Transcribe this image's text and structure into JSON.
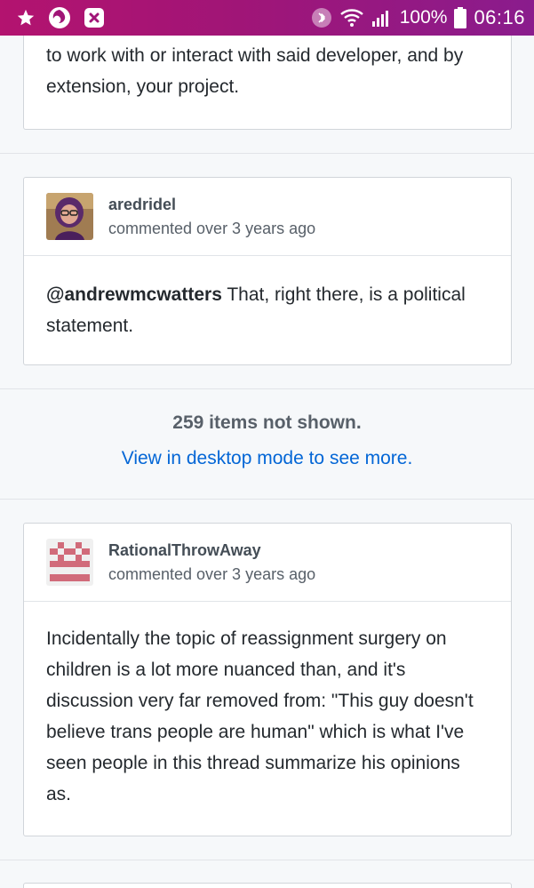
{
  "status_bar": {
    "left_icons": [
      "star-icon",
      "firefox-icon",
      "shield-icon"
    ],
    "right_icons": [
      "bluetooth-icon",
      "wifi-icon",
      "signal-icon"
    ],
    "battery": "100%",
    "time": "06:16"
  },
  "comments": [
    {
      "text": "to work with or interact with said developer, and by extension, your project.",
      "partial": true
    },
    {
      "username": "aredridel",
      "meta": "commented over 3 years ago",
      "mention": "@andrewmcwatters",
      "text": " That, right there, is a political statement."
    },
    {
      "username": "RationalThrowAway",
      "meta": "commented over 3 years ago",
      "text": "Incidentally the topic of reassignment surgery on children is a lot more nuanced than, and it's discussion very far removed from: \"This guy doesn't believe trans people are human\" which is what I've seen people in this thread summarize his opinions as."
    }
  ],
  "hidden_items": {
    "count_text": "259 items not shown.",
    "link_text": "View in desktop mode to see more."
  },
  "colors": {
    "status_bar_start": "#b3136f",
    "status_bar_end": "#8a1c8d",
    "link": "#0366d6",
    "border": "#d1d5da",
    "background": "#f6f8fa"
  }
}
